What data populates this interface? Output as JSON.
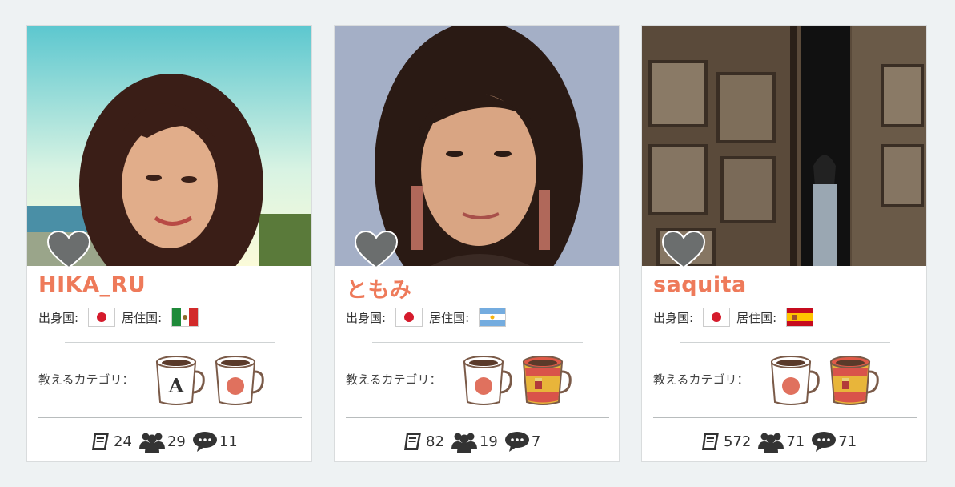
{
  "labels": {
    "origin": "出身国:",
    "residence": "居住国:",
    "teaches": "教えるカテゴリ："
  },
  "cards": [
    {
      "name": "HIKA_RU",
      "origin_flag": "japan-flag",
      "residence_flag": "mexico-flag",
      "mugs": [
        "english-mug-icon",
        "japanese-mug-icon"
      ],
      "stats": {
        "lessons": "24",
        "students": "29",
        "reviews": "11"
      }
    },
    {
      "name": "ともみ",
      "origin_flag": "japan-flag",
      "residence_flag": "argentina-flag",
      "mugs": [
        "japanese-mug-icon",
        "spanish-mug-icon"
      ],
      "stats": {
        "lessons": "82",
        "students": "19",
        "reviews": "7"
      }
    },
    {
      "name": "saquita",
      "origin_flag": "japan-flag",
      "residence_flag": "spain-flag",
      "mugs": [
        "japanese-mug-icon",
        "spanish-mug-icon"
      ],
      "stats": {
        "lessons": "572",
        "students": "71",
        "reviews": "71"
      }
    }
  ],
  "colors": {
    "name": "#ee7a5a",
    "background": "#eef2f3",
    "heart": "#6b6e6e"
  }
}
